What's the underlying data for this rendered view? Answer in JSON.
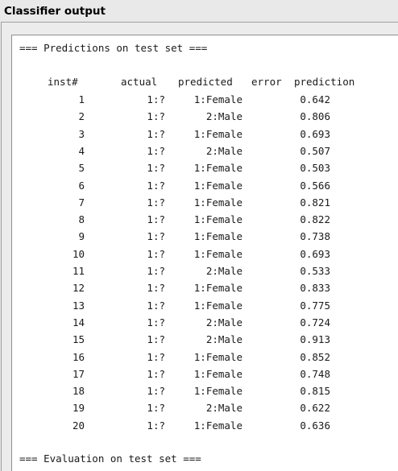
{
  "panel": {
    "title": "Classifier output"
  },
  "output": {
    "section_header": "=== Predictions on test set ===",
    "columns": {
      "inst": "inst#",
      "actual": "actual",
      "predicted": "predicted",
      "error": "error",
      "prediction": "prediction"
    },
    "rows": [
      {
        "inst": "1",
        "actual": "1:?",
        "predicted": "1:Female",
        "prediction": "0.642"
      },
      {
        "inst": "2",
        "actual": "1:?",
        "predicted": "2:Male",
        "prediction": "0.806"
      },
      {
        "inst": "3",
        "actual": "1:?",
        "predicted": "1:Female",
        "prediction": "0.693"
      },
      {
        "inst": "4",
        "actual": "1:?",
        "predicted": "2:Male",
        "prediction": "0.507"
      },
      {
        "inst": "5",
        "actual": "1:?",
        "predicted": "1:Female",
        "prediction": "0.503"
      },
      {
        "inst": "6",
        "actual": "1:?",
        "predicted": "1:Female",
        "prediction": "0.566"
      },
      {
        "inst": "7",
        "actual": "1:?",
        "predicted": "1:Female",
        "prediction": "0.821"
      },
      {
        "inst": "8",
        "actual": "1:?",
        "predicted": "1:Female",
        "prediction": "0.822"
      },
      {
        "inst": "9",
        "actual": "1:?",
        "predicted": "1:Female",
        "prediction": "0.738"
      },
      {
        "inst": "10",
        "actual": "1:?",
        "predicted": "1:Female",
        "prediction": "0.693"
      },
      {
        "inst": "11",
        "actual": "1:?",
        "predicted": "2:Male",
        "prediction": "0.533"
      },
      {
        "inst": "12",
        "actual": "1:?",
        "predicted": "1:Female",
        "prediction": "0.833"
      },
      {
        "inst": "13",
        "actual": "1:?",
        "predicted": "1:Female",
        "prediction": "0.775"
      },
      {
        "inst": "14",
        "actual": "1:?",
        "predicted": "2:Male",
        "prediction": "0.724"
      },
      {
        "inst": "15",
        "actual": "1:?",
        "predicted": "2:Male",
        "prediction": "0.913"
      },
      {
        "inst": "16",
        "actual": "1:?",
        "predicted": "1:Female",
        "prediction": "0.852"
      },
      {
        "inst": "17",
        "actual": "1:?",
        "predicted": "1:Female",
        "prediction": "0.748"
      },
      {
        "inst": "18",
        "actual": "1:?",
        "predicted": "1:Female",
        "prediction": "0.815"
      },
      {
        "inst": "19",
        "actual": "1:?",
        "predicted": "2:Male",
        "prediction": "0.622"
      },
      {
        "inst": "20",
        "actual": "1:?",
        "predicted": "1:Female",
        "prediction": "0.636"
      }
    ],
    "footer_header": "=== Evaluation on test set ==="
  }
}
